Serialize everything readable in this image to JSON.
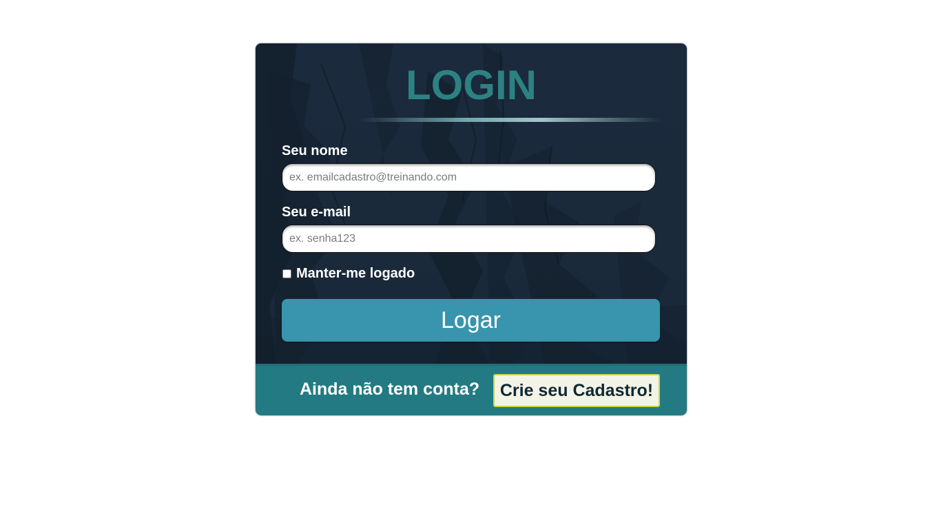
{
  "login_card": {
    "title": "LOGIN",
    "name_field": {
      "label": "Seu nome",
      "placeholder": "ex. emailcadastro@treinando.com",
      "value": ""
    },
    "email_field": {
      "label": "Seu e-mail",
      "placeholder": "ex. senha123",
      "value": ""
    },
    "remember_me": {
      "label": "Manter-me logado",
      "checked": false
    },
    "submit_label": "Logar"
  },
  "footer": {
    "prompt_text": "Ainda não tem conta?",
    "signup_label": "Crie seu Cadastro!"
  },
  "colors": {
    "title": "#2c8282",
    "panel_background": "#1b2a3c",
    "login_button": "#3895ad",
    "footer_background": "#237a82",
    "signup_button_background": "#f4f3e8",
    "signup_button_border": "#c9d84a"
  }
}
